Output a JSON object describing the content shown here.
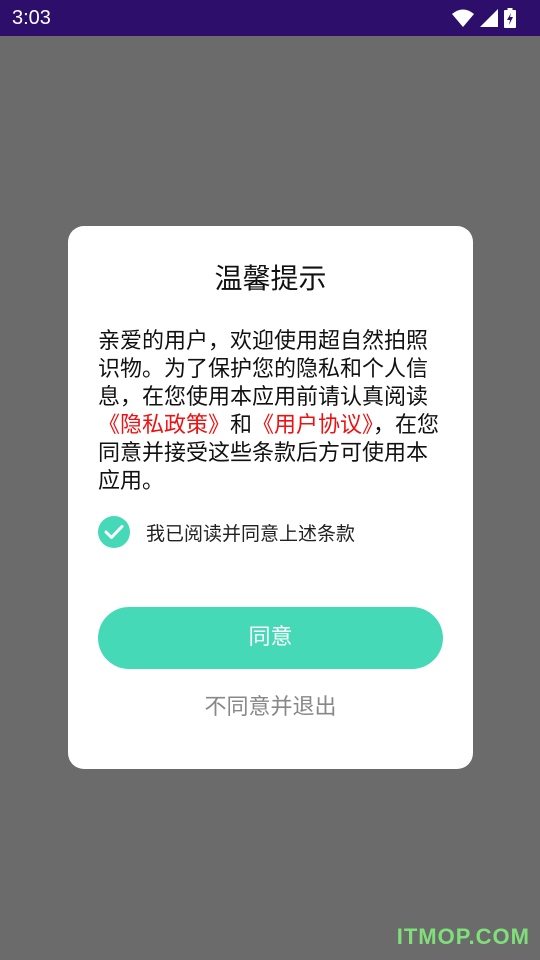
{
  "status_bar": {
    "time": "3:03",
    "icons": [
      "wifi-icon",
      "cell-signal-icon",
      "battery-icon"
    ]
  },
  "dialog": {
    "title": "温馨提示",
    "body": {
      "intro": "亲爱的用户，欢迎使用超自然拍照识物。为了保护您的隐私和个人信息，在您使用本应用前请认真阅读",
      "privacy_link": "《隐私政策》",
      "and": "和",
      "terms_link": "《用户协议》",
      "outro": "，在您同意并接受这些条款后方可使用本应用。"
    },
    "consent": {
      "label": "我已阅读并同意上述条款",
      "checked": true
    },
    "agree_button": "同意",
    "disagree_button": "不同意并退出"
  },
  "watermark": "ITMOP.COM",
  "colors": {
    "accent": "#46d9b8",
    "link": "#ee1111",
    "status_bar": "#2d0f6b",
    "overlay": "#6b6b6b"
  }
}
